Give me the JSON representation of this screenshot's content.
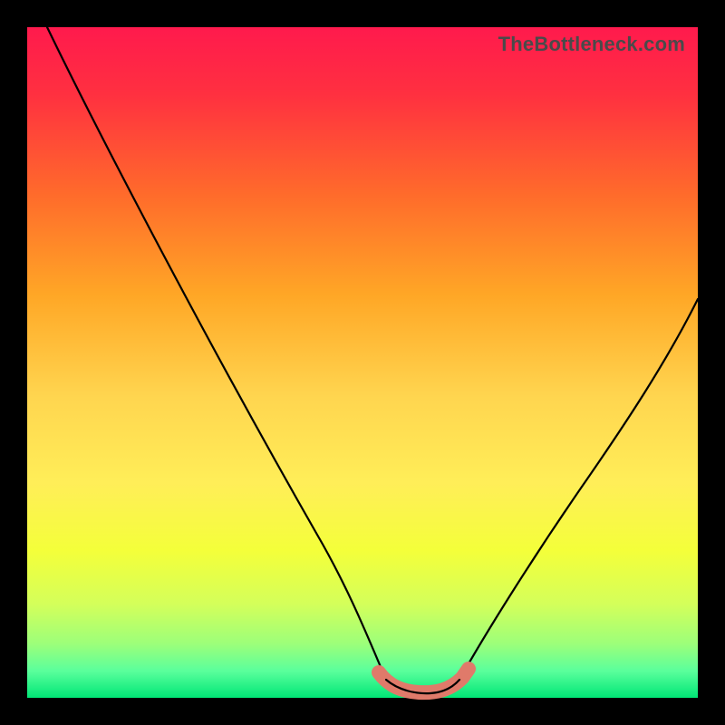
{
  "watermark": "TheBottleneck.com",
  "chart_data": {
    "type": "line",
    "title": "",
    "xlabel": "",
    "ylabel": "",
    "xlim": [
      0,
      100
    ],
    "ylim": [
      0,
      100
    ],
    "grid": false,
    "legend": false,
    "series": [
      {
        "name": "left-branch",
        "x": [
          3,
          10,
          20,
          30,
          40,
          47,
          50,
          52,
          53.5
        ],
        "y": [
          100,
          88,
          71,
          53,
          36,
          22,
          12,
          5,
          1.5
        ]
      },
      {
        "name": "valley-floor",
        "x": [
          53.5,
          55,
          57,
          59,
          61,
          63,
          64.5
        ],
        "y": [
          1.5,
          0.8,
          0.6,
          0.6,
          0.8,
          1.2,
          1.8
        ]
      },
      {
        "name": "right-branch",
        "x": [
          64.5,
          68,
          74,
          82,
          90,
          100
        ],
        "y": [
          1.8,
          6,
          16,
          30,
          44,
          62
        ]
      }
    ],
    "highlight": {
      "name": "valley-highlight",
      "x": [
        52,
        54,
        56,
        58,
        60,
        62,
        64,
        66
      ],
      "y": [
        3.5,
        1.8,
        1.0,
        0.8,
        0.8,
        1.2,
        1.8,
        3.2
      ],
      "color": "#e07a6a"
    },
    "background_gradient": {
      "top": "#ff1a4d",
      "bottom": "#00e676"
    }
  }
}
